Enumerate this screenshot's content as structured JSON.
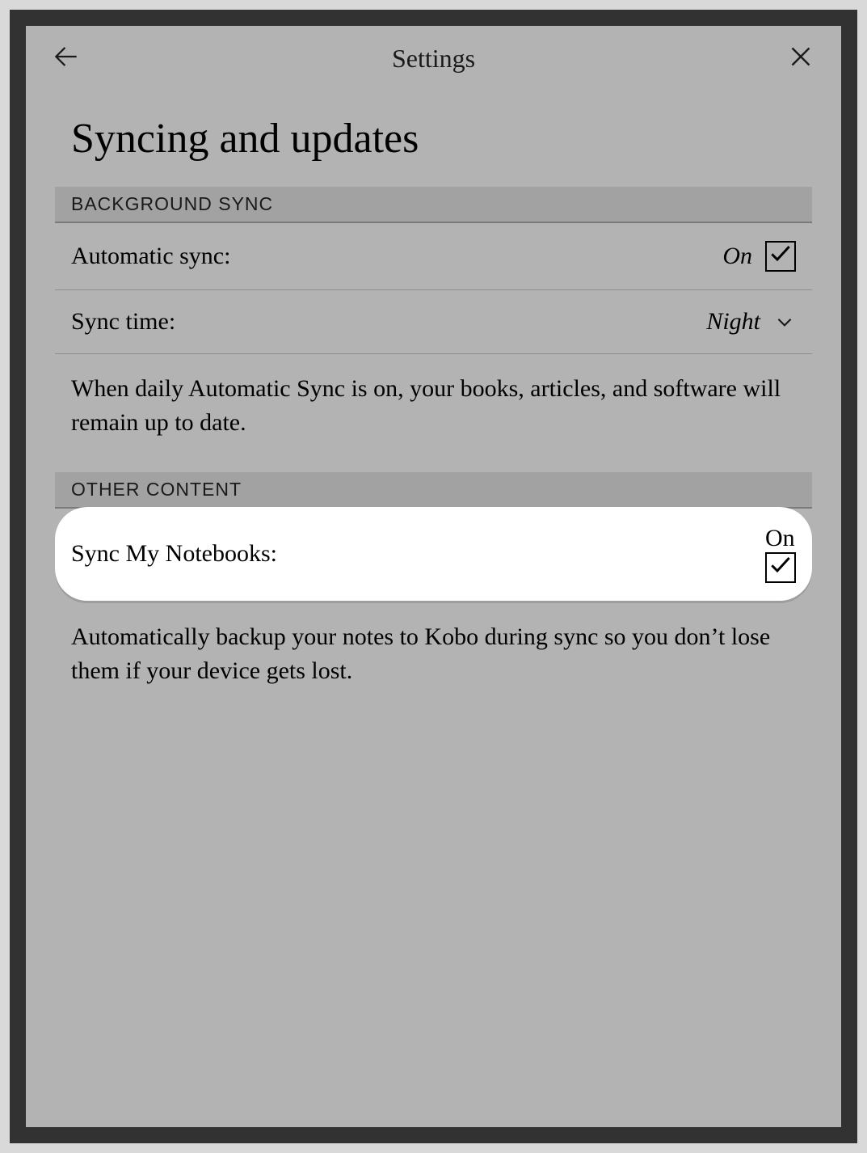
{
  "header": {
    "title": "Settings"
  },
  "page": {
    "title": "Syncing and updates"
  },
  "sections": {
    "background_sync": {
      "header": "BACKGROUND SYNC",
      "automatic_sync": {
        "label": "Automatic sync:",
        "value": "On",
        "checked": true
      },
      "sync_time": {
        "label": "Sync time:",
        "value": "Night"
      },
      "description": "When daily Automatic Sync is on, your books, articles, and software will remain up to date."
    },
    "other_content": {
      "header": "OTHER CONTENT",
      "sync_notebooks": {
        "label": "Sync My Notebooks:",
        "value": "On",
        "checked": true
      },
      "description": "Automatically backup your notes to Kobo during sync so you don’t lose them if your device gets lost."
    }
  }
}
